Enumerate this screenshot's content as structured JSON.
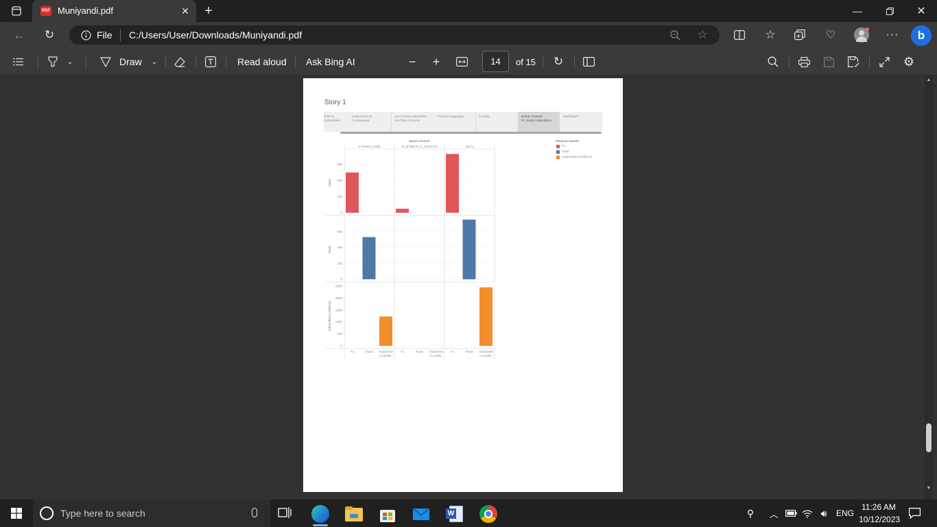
{
  "browser": {
    "tab_title": "Muniyandi.pdf",
    "file_label": "File",
    "url": "C:/Users/User/Downloads/Muniyandi.pdf"
  },
  "toolbar": {
    "draw_label": "Draw",
    "read_aloud_label": "Read aloud",
    "ask_bing_label": "Ask Bing AI",
    "page_current": "14",
    "page_total": "of 15"
  },
  "pdf": {
    "story_title": "Story 1",
    "story_tabs": [
      "Rank &\nSubscribers",
      "Subscribers in\nCountrywise",
      "List of most subscribed\nYouTube Channel",
      "Primary Languages",
      "Country",
      "Brand Channel\nF1, Rank,Subscribers",
      "Dashboard"
    ],
    "chart_header": "Brand channel",
    "columns": [
      "5 minutes crafts",
      "As of March 14, 2023UTC",
      "zee tv"
    ],
    "legend_title": "Measure Names",
    "legend_items": [
      "F1",
      "Rank",
      "Subscribers (millions)"
    ],
    "row_labels": [
      "Value",
      "Rank",
      "Subscribers (millions)"
    ],
    "ticks_value": [
      "600",
      "400",
      "200",
      "0"
    ],
    "ticks_rank": [
      "600",
      "400",
      "200",
      "0"
    ],
    "ticks_subs": [
      "2500",
      "2000",
      "1500",
      "1000",
      "500",
      "0"
    ],
    "x_labels": [
      "F1",
      "Rank",
      "Subscribe\nrs (millio..",
      "F1",
      "Rank",
      "Subscribe\nrs (millio..",
      "F1",
      "Rank",
      "Subscribe\nrs (millio.."
    ]
  },
  "chart_data": {
    "type": "bar",
    "title": "Brand channel",
    "categories": [
      "5 minutes crafts",
      "As of March 14, 2023UTC",
      "zee tv"
    ],
    "series": [
      {
        "name": "F1",
        "values": [
          500,
          50,
          730
        ],
        "color": "#e05759"
      },
      {
        "name": "Rank",
        "values": [
          530,
          0,
          750
        ],
        "color": "#4e79a7"
      },
      {
        "name": "Subscribers (millions)",
        "values": [
          1230,
          0,
          2450
        ],
        "color": "#f28e2b"
      }
    ],
    "ylim": [
      [
        0,
        750
      ],
      [
        0,
        750
      ],
      [
        0,
        2500
      ]
    ]
  },
  "taskbar": {
    "search_placeholder": "Type here to search",
    "lang": "ENG",
    "time": "11:26 AM",
    "date": "10/12/2023"
  }
}
